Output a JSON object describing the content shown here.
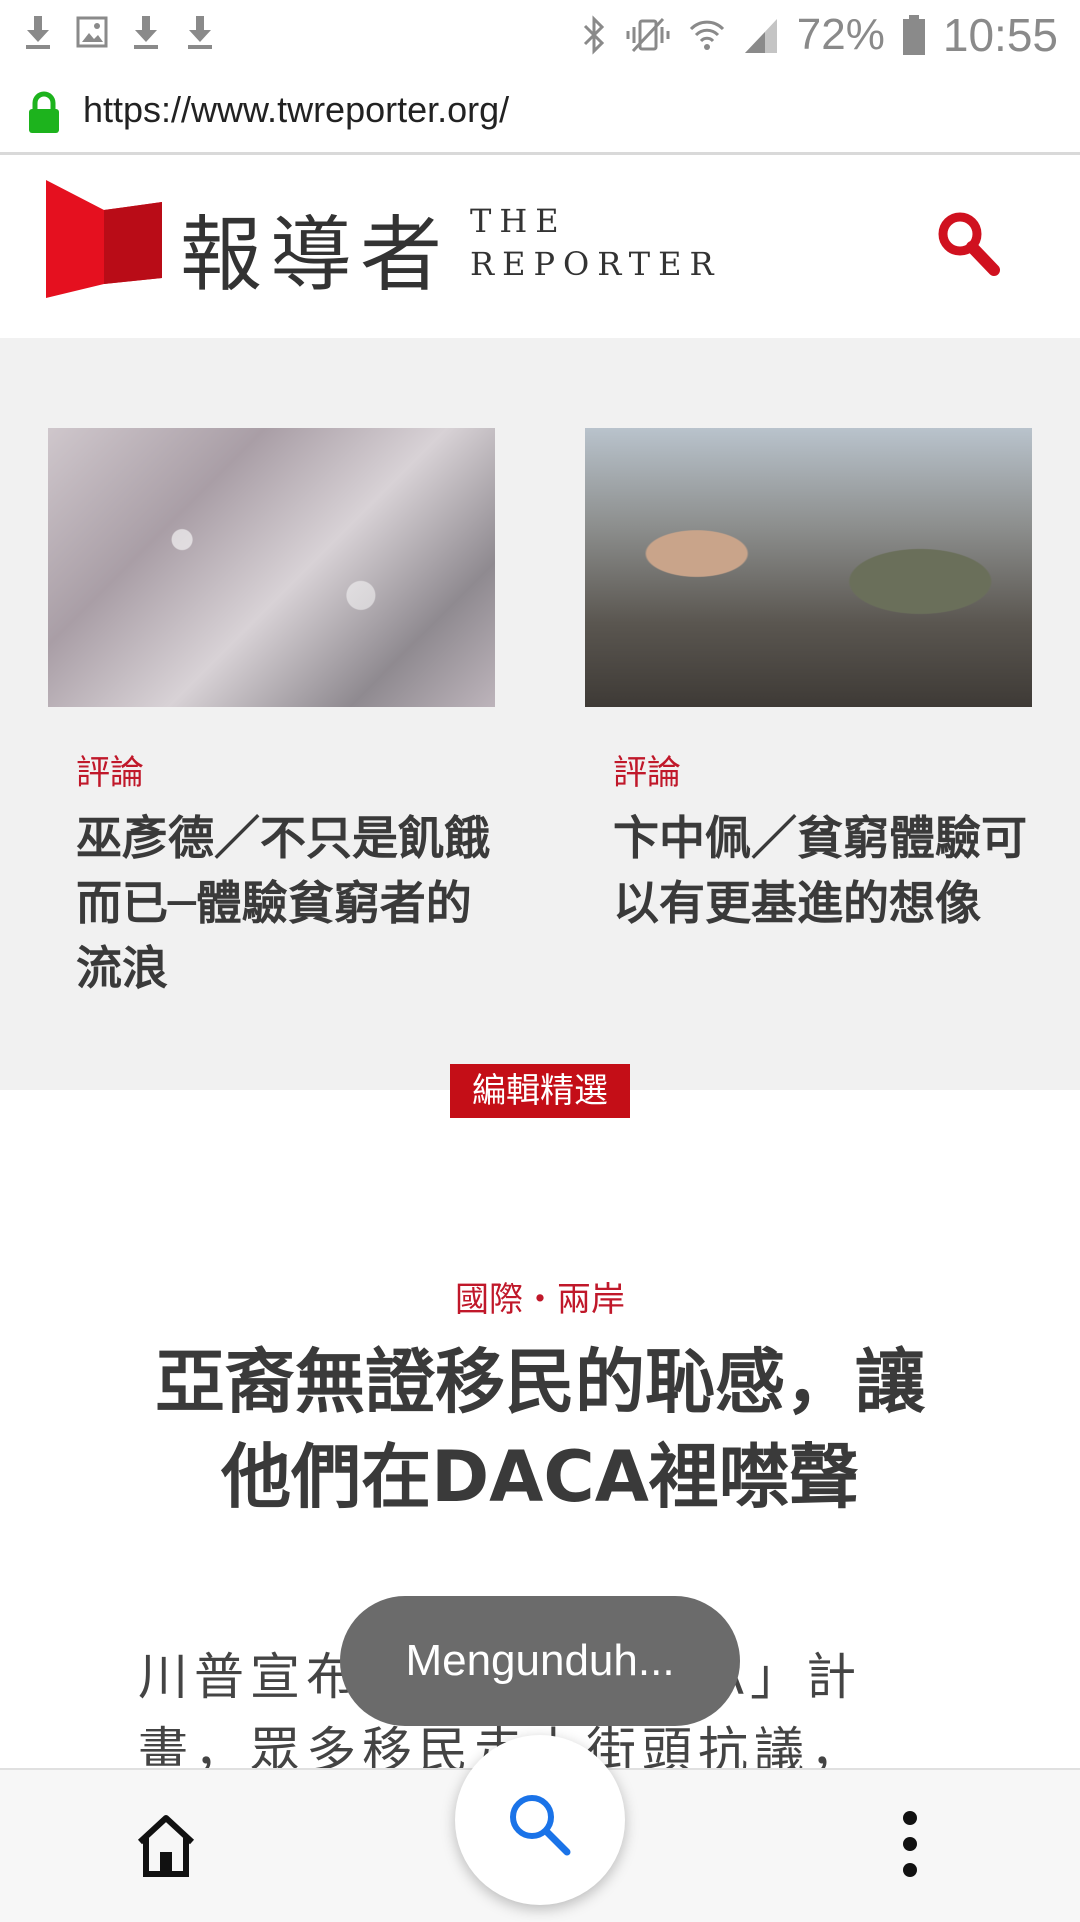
{
  "status_bar": {
    "battery_percent": "72%",
    "time": "10:55",
    "left_icons": [
      "download-icon",
      "image-icon",
      "download-icon",
      "download-icon"
    ],
    "right_icons": [
      "bluetooth-icon",
      "vibrate-icon",
      "wifi-icon",
      "signal-icon",
      "battery-icon"
    ]
  },
  "browser": {
    "url": "https://www.twreporter.org/"
  },
  "site_header": {
    "logo_cjk": "報導者",
    "logo_en_line1": "THE",
    "logo_en_line2": "REPORTER"
  },
  "featured": [
    {
      "category": "評論",
      "title": "巫彥德／不只是飢餓而已─體驗貧窮者的流浪"
    },
    {
      "category": "評論",
      "title": "卞中佩／貧窮體驗可以有更基進的想像"
    }
  ],
  "editor_badge": "編輯精選",
  "main_article": {
    "category": "國際・兩岸",
    "title": "亞裔無證移民的恥感，讓他們在DACA裡噤聲",
    "excerpt": "川普宣布將終止「DACA」計畫，眾多移民走上街頭抗議，"
  },
  "toast": "Mengunduh...",
  "colors": {
    "brand_red": "#c40e17",
    "category_red": "#c0182a",
    "link_blue": "#1a73e8",
    "lock_green": "#1db31d"
  }
}
